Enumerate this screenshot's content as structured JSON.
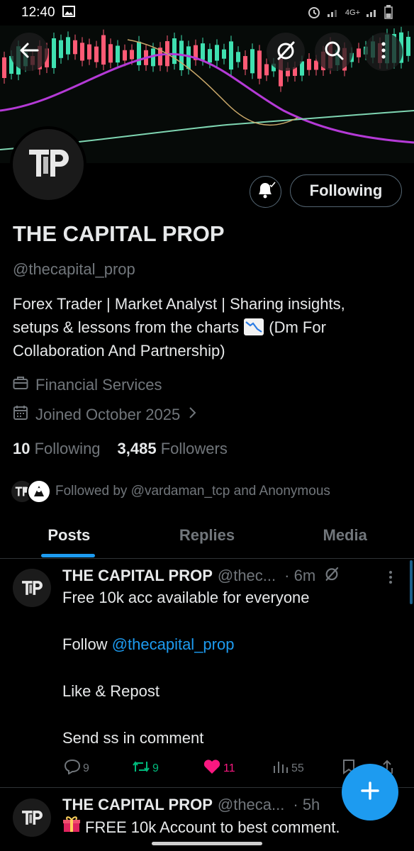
{
  "status_bar": {
    "time": "12:40",
    "network": "4G+"
  },
  "profile": {
    "display_name": "THE CAPITAL PROP",
    "handle": "@thecapital_prop",
    "bio_line1": "Forex Trader | Market Analyst | Sharing insights,",
    "bio_line2a": "setups & lessons from the charts",
    "bio_line2b": "(Dm For",
    "bio_line3": "Collaboration And Partnership)",
    "category": "Financial Services",
    "joined": "Joined October 2025",
    "following_count": "10",
    "following_label": "Following",
    "followers_count": "3,485",
    "followers_label": "Followers",
    "followed_by": "Followed by @vardaman_tcp and Anonymous",
    "follow_button": "Following"
  },
  "tabs": [
    {
      "label": "Posts",
      "active": true
    },
    {
      "label": "Replies",
      "active": false
    },
    {
      "label": "Media",
      "active": false
    }
  ],
  "posts": [
    {
      "name": "THE CAPITAL PROP",
      "handle": "@thec...",
      "time": "· 6m",
      "line1": "Free 10k acc available for everyone",
      "line2_prefix": "Follow ",
      "line2_link": "@thecapital_prop",
      "line3": "Like & Repost",
      "line4": "Send ss in comment",
      "replies": "9",
      "reposts": "9",
      "likes": "11",
      "views": "55"
    },
    {
      "name": "THE CAPITAL PROP",
      "handle": "@theca...",
      "time": "· 5h",
      "text": "FREE 10k Account to best comment."
    }
  ],
  "colors": {
    "accent": "#1d9bf0",
    "muted": "#71767b",
    "like": "#f91880",
    "repost": "#00ba7c",
    "background": "#000000"
  },
  "icons": [
    "back-arrow-icon",
    "grok-icon",
    "search-icon",
    "more-vertical-icon",
    "bell-icon",
    "briefcase-icon",
    "calendar-icon",
    "chevron-right-icon",
    "reply-icon",
    "repost-icon",
    "like-icon",
    "views-icon",
    "bookmark-icon",
    "share-icon",
    "plus-icon",
    "chart-down-emoji",
    "gift-emoji"
  ]
}
